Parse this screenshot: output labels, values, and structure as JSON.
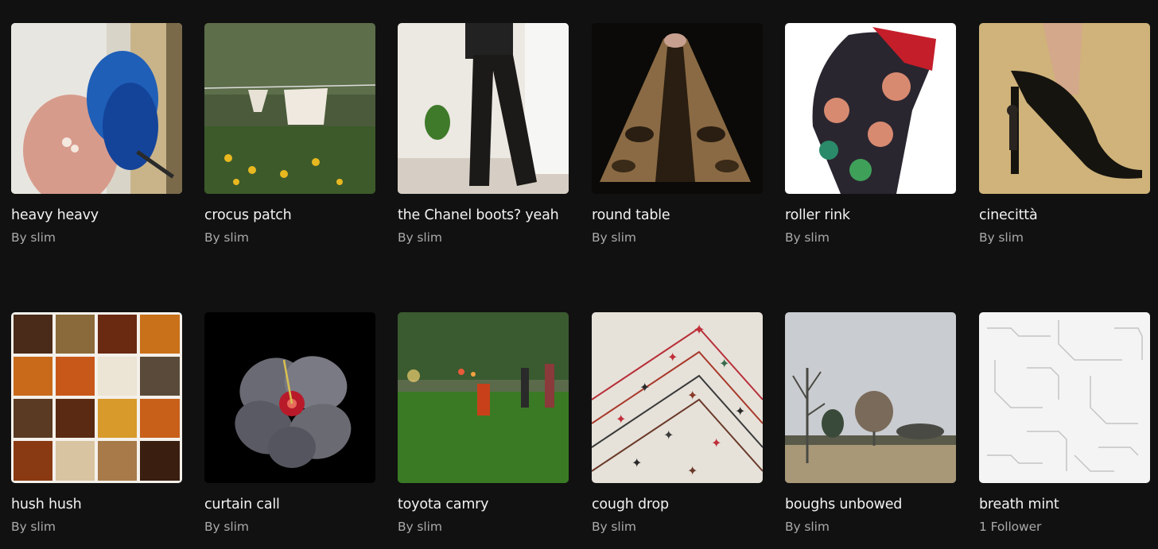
{
  "collections": [
    {
      "title": "heavy heavy",
      "subtitle": "By slim"
    },
    {
      "title": "crocus patch",
      "subtitle": "By slim"
    },
    {
      "title": "the Chanel boots? yeah",
      "subtitle": "By slim"
    },
    {
      "title": "round table",
      "subtitle": "By slim"
    },
    {
      "title": "roller rink",
      "subtitle": "By slim"
    },
    {
      "title": "cinecittà",
      "subtitle": "By slim"
    },
    {
      "title": "hush hush",
      "subtitle": "By slim"
    },
    {
      "title": "curtain call",
      "subtitle": "By slim"
    },
    {
      "title": "toyota camry",
      "subtitle": "By slim"
    },
    {
      "title": "cough drop",
      "subtitle": "By slim"
    },
    {
      "title": "boughs unbowed",
      "subtitle": "By slim"
    },
    {
      "title": "breath mint",
      "subtitle": "1 Follower"
    }
  ]
}
